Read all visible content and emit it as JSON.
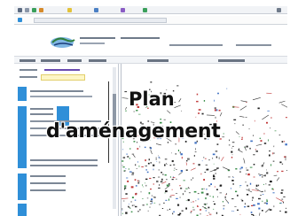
{
  "overlay": {
    "title_line_1": "Plan",
    "title_line_2": "d'aménagement"
  },
  "colors": {
    "accent": "#2f8fd8",
    "brand": "#1b3d7a",
    "highlight": "#fdf6c6"
  },
  "icons": [
    "back-icon",
    "forward-icon",
    "refresh-icon",
    "home-icon",
    "star-icon",
    "menu-icon"
  ]
}
